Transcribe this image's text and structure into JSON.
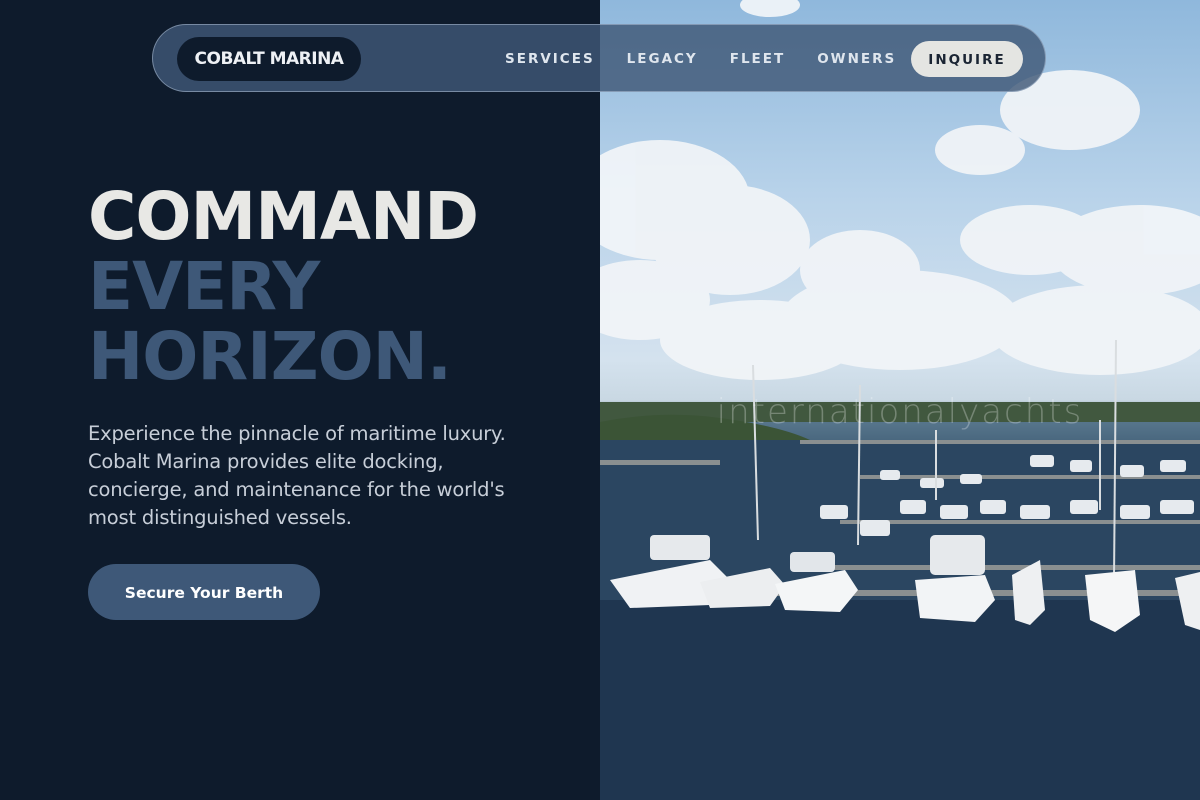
{
  "nav": {
    "brand": "COBALT MARINA",
    "links": [
      "SERVICES",
      "LEGACY",
      "FLEET",
      "OWNERS"
    ],
    "cta": "INQUIRE"
  },
  "hero": {
    "headline_line1": "COMMAND",
    "headline_line2": "EVERY",
    "headline_line3": "HORIZON.",
    "description": "Experience the pinnacle of maritime luxury. Cobalt Marina provides elite docking, concierge, and maintenance for the world's most distinguished vessels.",
    "cta_label": "Secure Your Berth"
  },
  "photo": {
    "subject": "aerial view of marina with docked yachts",
    "watermark": "internationalyachts"
  },
  "colors": {
    "background": "#0e1b2c",
    "accent": "#3e5878",
    "headline_light": "#e8e8e5",
    "inquire_bg": "#e4e5e2"
  }
}
